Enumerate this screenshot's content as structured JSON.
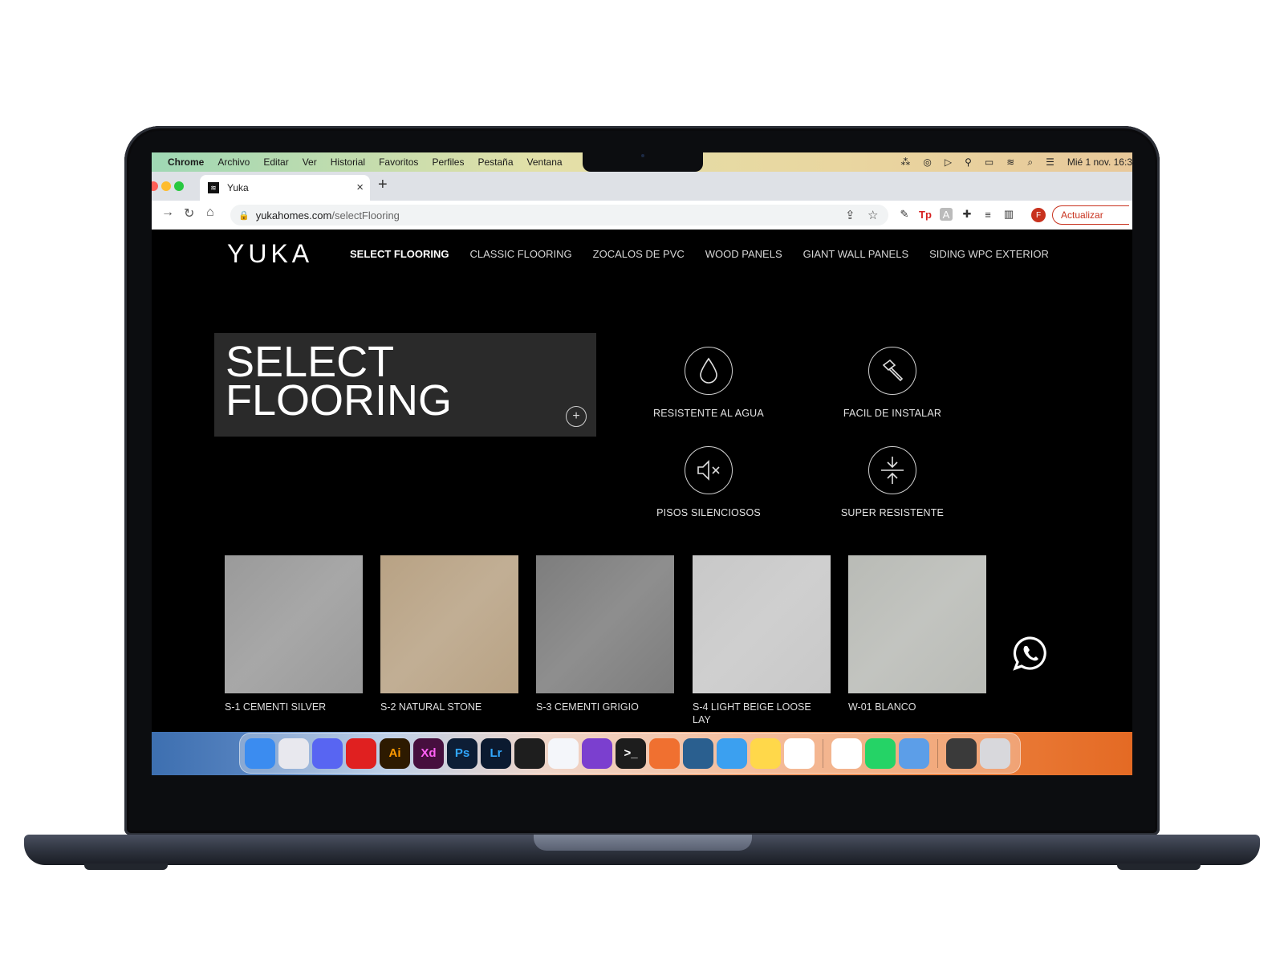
{
  "menubar": {
    "app": "Chrome",
    "items": [
      "Archivo",
      "Editar",
      "Ver",
      "Historial",
      "Favoritos",
      "Perfiles",
      "Pestaña",
      "Ventana"
    ],
    "datetime": "Mié 1 nov.  16:3"
  },
  "browser": {
    "tab_title": "Yuka",
    "url_domain": "yukahomes.com",
    "url_path": "/selectFlooring",
    "profile_initial": "F",
    "update_label": "Actualizar"
  },
  "site": {
    "logo": "YUKA",
    "nav": [
      "SELECT FLOORING",
      "CLASSIC FLOORING",
      "ZOCALOS DE PVC",
      "WOOD PANELS",
      "GIANT WALL PANELS",
      "SIDING WPC EXTERIOR"
    ],
    "hero": {
      "line1": "SELECT",
      "line2": "FLOORING",
      "expand": "+"
    },
    "features": [
      {
        "label": "RESISTENTE AL AGUA",
        "icon": "water-drop-icon"
      },
      {
        "label": "FACIL DE INSTALAR",
        "icon": "hammer-icon"
      },
      {
        "label": "PISOS SILENCIOSOS",
        "icon": "muted-speaker-icon"
      },
      {
        "label": "SUPER RESISTENTE",
        "icon": "compress-arrows-icon"
      }
    ],
    "products": [
      {
        "name": "S-1 CEMENTI SILVER",
        "color": "#9a9a9a"
      },
      {
        "name": "S-2 NATURAL STONE",
        "color": "#b8a284"
      },
      {
        "name": "S-3 CEMENTI GRIGIO",
        "color": "#7d7d7d"
      },
      {
        "name": "S-4 LIGHT BEIGE LOOSE LAY",
        "color": "#c8c8c8"
      },
      {
        "name": "W-01 BLANCO",
        "color": "#b9bbb6"
      }
    ]
  },
  "dock": {
    "apps": [
      {
        "name": "finder-icon",
        "label": "",
        "color": "#3b8cf0"
      },
      {
        "name": "launchpad-icon",
        "label": "",
        "color": "#e8e8ee"
      },
      {
        "name": "discord-icon",
        "label": "",
        "color": "#5865f2"
      },
      {
        "name": "youtube-music-icon",
        "label": "",
        "color": "#e02020"
      },
      {
        "name": "illustrator-icon",
        "label": "Ai",
        "color": "#2d1a00"
      },
      {
        "name": "xd-icon",
        "label": "Xd",
        "color": "#460f3e"
      },
      {
        "name": "photoshop-icon",
        "label": "Ps",
        "color": "#0d1e36"
      },
      {
        "name": "lightroom-icon",
        "label": "Lr",
        "color": "#0b1a30"
      },
      {
        "name": "figma-icon",
        "label": "",
        "color": "#1e1e1e"
      },
      {
        "name": "vscode-icon",
        "label": "",
        "color": "#f4f6fa"
      },
      {
        "name": "github-desktop-icon",
        "label": "",
        "color": "#7b3fcf"
      },
      {
        "name": "terminal-icon",
        "label": ">_",
        "color": "#1d1d1d"
      },
      {
        "name": "pen-tool-icon",
        "label": "",
        "color": "#f07030"
      },
      {
        "name": "dolphin-icon",
        "label": "",
        "color": "#2a5f8f"
      },
      {
        "name": "mail-icon",
        "label": "",
        "color": "#3ba0f0"
      },
      {
        "name": "notes-icon",
        "label": "",
        "color": "#ffd84a"
      },
      {
        "name": "slack-icon",
        "label": "",
        "color": "#ffffff"
      },
      {
        "name": "chrome-icon",
        "label": "",
        "color": "#ffffff"
      },
      {
        "name": "whatsapp-icon",
        "label": "",
        "color": "#25d366"
      },
      {
        "name": "preview-icon",
        "label": "",
        "color": "#5c9ee8"
      },
      {
        "name": "iphone-mirroring-icon",
        "label": "",
        "color": "#3a3a3a"
      },
      {
        "name": "trash-icon",
        "label": "",
        "color": "#d8d8dc"
      }
    ]
  }
}
